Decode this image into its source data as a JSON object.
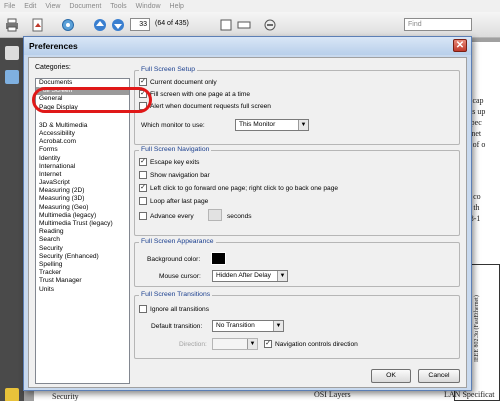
{
  "menubar": [
    "File",
    "Edit",
    "View",
    "Document",
    "Tools",
    "Window",
    "Help"
  ],
  "toolbar": {
    "page_number": "33",
    "page_count": "(64 of 435)",
    "find_placeholder": "Find"
  },
  "document": {
    "fragments": [
      "lavor cap",
      "speeds up",
      "ster spec",
      "Ethernet",
      "s and of o",
      "are is co",
      "dards th",
      "are 28-1",
      "del",
      "IEEE 802.3u (FastEthernet)",
      "Security",
      "OSI Layers",
      "LAN Specificat"
    ]
  },
  "dialog": {
    "title": "Preferences",
    "close_glyph": "✕",
    "categories_label": "Categories:",
    "categories_top": [
      "Documents",
      "Full Screen",
      "General",
      "Page Display"
    ],
    "categories_bottom": [
      "3D & Multimedia",
      "Accessibility",
      "Acrobat.com",
      "Forms",
      "Identity",
      "International",
      "Internet",
      "JavaScript",
      "Measuring (2D)",
      "Measuring (3D)",
      "Measuring (Geo)",
      "Multimedia (legacy)",
      "Multimedia Trust (legacy)",
      "Reading",
      "Search",
      "Security",
      "Security (Enhanced)",
      "Spelling",
      "Tracker",
      "Trust Manager",
      "Units"
    ],
    "setup": {
      "title": "Full Screen Setup",
      "current_doc_only": "Current document only",
      "fill_screen": "Fill screen with one page at a time",
      "alert_when": "Alert when document requests full screen",
      "monitor_label": "Which monitor to use:",
      "monitor_value": "This Monitor"
    },
    "navigation": {
      "title": "Full Screen Navigation",
      "escape_exits": "Escape key exits",
      "show_nav_bar": "Show navigation bar",
      "left_click": "Left click to go forward one page; right click to go back one page",
      "loop": "Loop after last page",
      "advance_every": "Advance every",
      "seconds": "seconds"
    },
    "appearance": {
      "title": "Full Screen Appearance",
      "bg_color_label": "Background color:",
      "mouse_cursor_label": "Mouse cursor:",
      "mouse_cursor_value": "Hidden After Delay"
    },
    "transitions": {
      "title": "Full Screen Transitions",
      "ignore_all": "Ignore all transitions",
      "default_label": "Default transition:",
      "default_value": "No Transition",
      "direction_label": "Direction:",
      "nav_controls_direction": "Navigation controls direction"
    },
    "ok_label": "OK",
    "cancel_label": "Cancel"
  },
  "colors": {
    "selected_category": "#9a9a9a",
    "group_title": "#1a3f8f",
    "highlight_ring": "#e01818",
    "background_color_swatch": "#000000"
  }
}
